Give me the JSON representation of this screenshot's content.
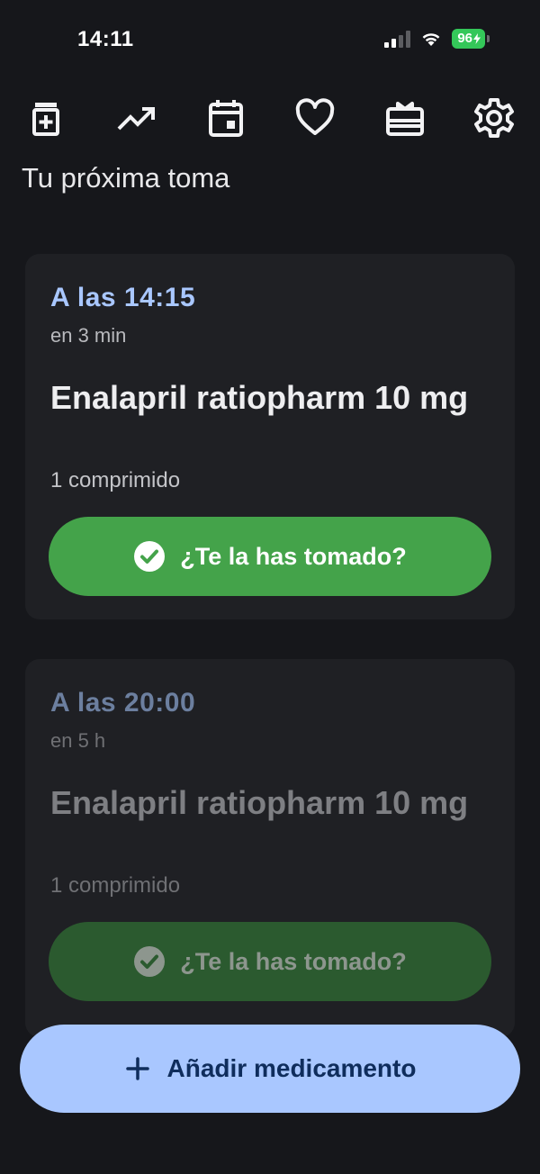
{
  "status_bar": {
    "time": "14:11",
    "battery": "96"
  },
  "toolbar": {
    "icons": [
      "medication-icon",
      "trending-up-icon",
      "calendar-icon",
      "heart-icon",
      "gift-card-icon",
      "gear-icon"
    ]
  },
  "section_title": "Tu próxima toma",
  "doses": [
    {
      "time": "A las 14:15",
      "relative": "en 3 min",
      "medication": "Enalapril ratiopharm 10 mg",
      "dose": "1 comprimido",
      "button": "¿Te la has tomado?",
      "state": "active"
    },
    {
      "time": "A las 20:00",
      "relative": "en 5 h",
      "medication": "Enalapril ratiopharm 10 mg",
      "dose": "1 comprimido",
      "button": "¿Te la has tomado?",
      "state": "upcoming"
    }
  ],
  "add_button": "Añadir medicamento",
  "colors": {
    "background": "#16171b",
    "card": "#1f2024",
    "accent_blue": "#a9c7ff",
    "green": "#44a34a",
    "green_muted": "#2b5a2f"
  }
}
